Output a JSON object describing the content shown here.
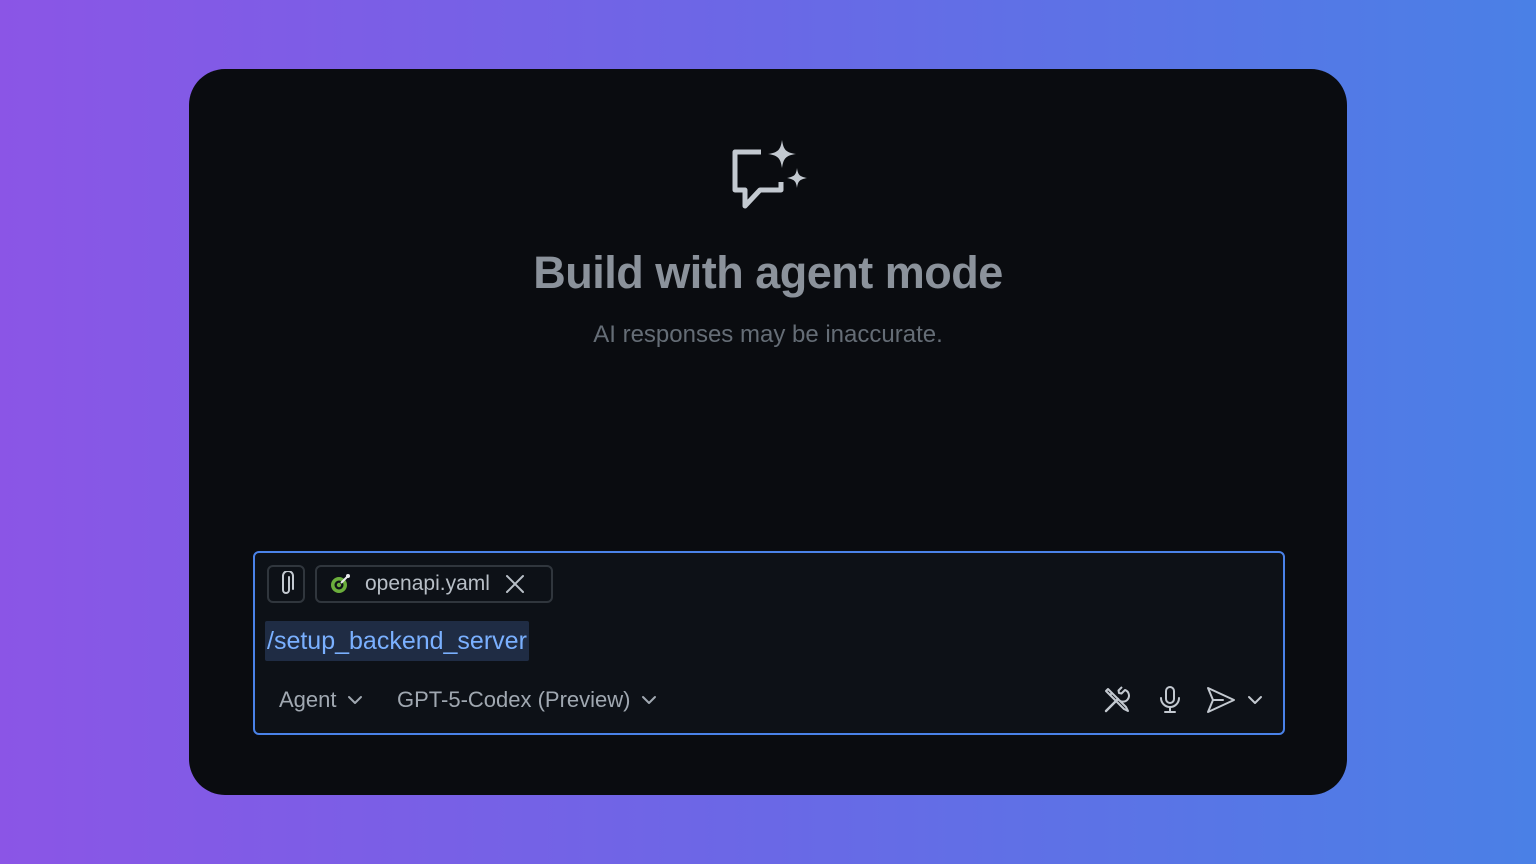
{
  "hero": {
    "icon": "chat-sparkle-icon",
    "title": "Build with agent mode",
    "subtitle": "AI responses may be inaccurate."
  },
  "composer": {
    "attach_icon": "paperclip-icon",
    "attachment": {
      "file_name": "openapi.yaml",
      "icon": "openapi-file-icon",
      "remove_icon": "close-icon"
    },
    "prompt_command": "/setup_backend_server",
    "mode": "Agent",
    "model": "GPT-5-Codex (Preview)",
    "actions": {
      "tools_icon": "tools-icon",
      "mic_icon": "microphone-icon",
      "send_icon": "send-icon",
      "send_menu_icon": "chevron-down-icon"
    }
  },
  "colors": {
    "accent_border": "#4a82e8",
    "command_text": "#7ab0ff",
    "window_bg": "#0a0c10"
  }
}
